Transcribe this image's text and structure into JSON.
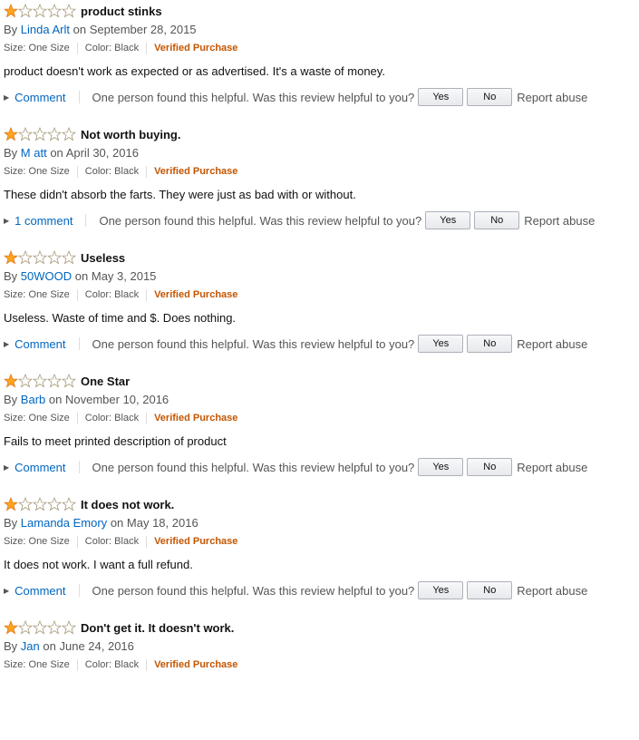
{
  "colors": {
    "link": "#0066c0",
    "verified": "#c45500",
    "star_fill": "#ffa41c"
  },
  "icons": {
    "star_filled": "star-filled-icon",
    "star_empty": "star-empty-icon",
    "caret": "caret-right-icon"
  },
  "labels": {
    "by": "By",
    "on": "on",
    "size": "Size: One Size",
    "color": "Color: Black",
    "verified": "Verified Purchase",
    "helpful_question": "One person found this helpful. Was this review helpful to you?",
    "yes": "Yes",
    "no": "No",
    "report": "Report abuse"
  },
  "reviews": [
    {
      "rating": 1,
      "title": "product stinks",
      "author": "Linda Arlt",
      "date": "September 28, 2015",
      "text": "product doesn't work as expected or as advertised. It's a waste of money.",
      "comment_label": "Comment"
    },
    {
      "rating": 1,
      "title": "Not worth buying.",
      "author": "M att",
      "date": "April 30, 2016",
      "text": "These didn't absorb the farts. They were just as bad with or without.",
      "comment_label": "1 comment"
    },
    {
      "rating": 1,
      "title": "Useless",
      "author": "50WOOD",
      "date": "May 3, 2015",
      "text": "Useless. Waste of time and $. Does nothing.",
      "comment_label": "Comment"
    },
    {
      "rating": 1,
      "title": "One Star",
      "author": "Barb",
      "date": "November 10, 2016",
      "text": "Fails to meet printed description of product",
      "comment_label": "Comment"
    },
    {
      "rating": 1,
      "title": "It does not work.",
      "author": "Lamanda Emory",
      "date": "May 18, 2016",
      "text": "It does not work. I want a full refund.",
      "comment_label": "Comment"
    },
    {
      "rating": 1,
      "title": "Don't get it. It doesn't work.",
      "author": "Jan",
      "date": "June 24, 2016",
      "text": "",
      "comment_label": ""
    }
  ]
}
